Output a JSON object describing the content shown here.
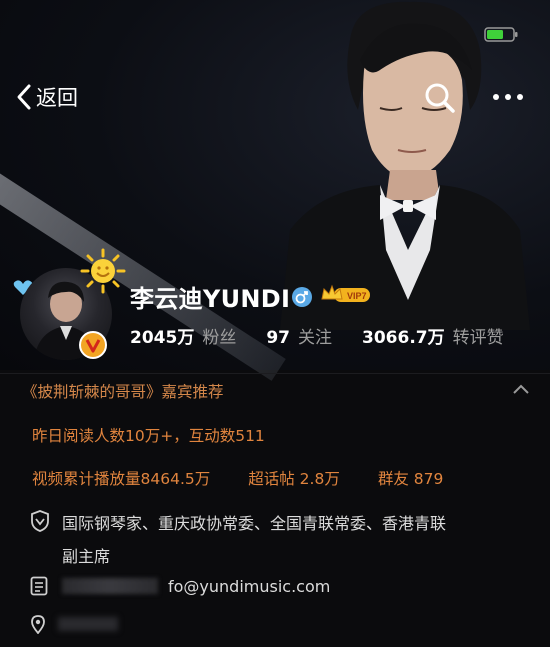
{
  "topbar": {
    "back_label": "返回"
  },
  "profile": {
    "name": "李云迪YUNDI",
    "vip_label": "VIP7",
    "stats": [
      {
        "num": "2045万",
        "label": "粉丝"
      },
      {
        "num": "97",
        "label": "关注"
      },
      {
        "num": "3066.7万",
        "label": "转评赞"
      }
    ]
  },
  "info": {
    "guest_recommend": "《披荆斩棘的哥哥》嘉宾推荐",
    "yesterday_reads": "昨日阅读人数10万+，互动数511",
    "video_plays": "视频累计播放量8464.5万",
    "topic_posts": "超话帖 2.8万",
    "group_friends": "群友 879",
    "title_line1": "国际钢琴家、重庆政协常委、全国青联常委、香港青联",
    "title_line2": "副主席",
    "email_suffix": "fo@yundimusic.com"
  },
  "colors": {
    "background": "#0b0b0d",
    "accent_orange": "#e0843e",
    "battery_green": "#3fd13a",
    "vip_gold": "#f2b21e",
    "male_blue": "#5aa9e6"
  },
  "icons": [
    "back-chevron-icon",
    "search-icon",
    "more-icon",
    "battery-icon",
    "sun-icon",
    "heart-icon",
    "verified-v-icon",
    "male-icon",
    "vip-crown-icon",
    "chevron-up-icon",
    "shield-icon",
    "document-icon",
    "location-icon"
  ]
}
